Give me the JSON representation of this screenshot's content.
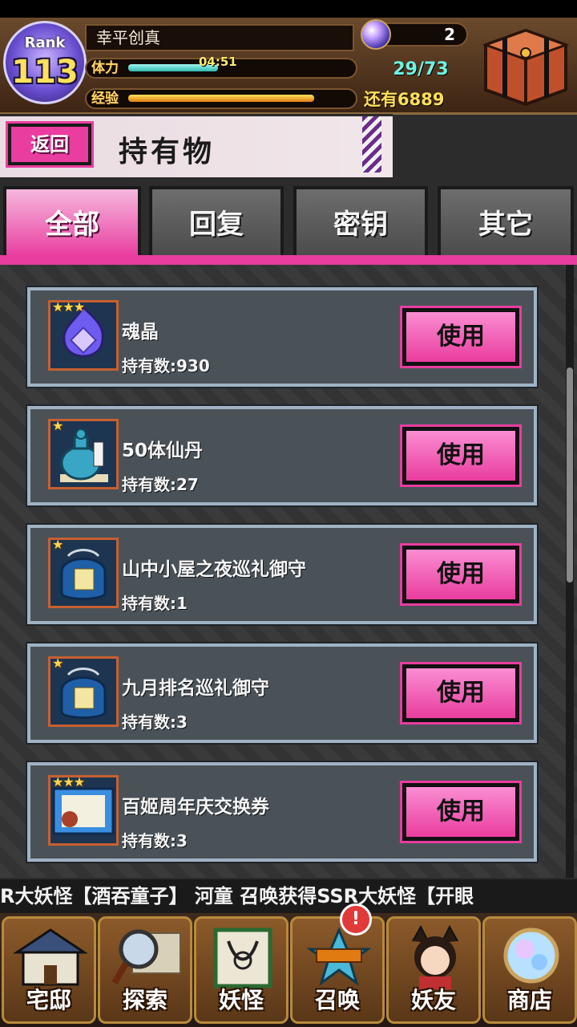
{
  "header": {
    "rank_label": "Rank",
    "rank_value": "113",
    "player_name": "幸平创真",
    "stamina_label": "体力",
    "stamina_timer": "04:51",
    "stamina_count": "29/73",
    "stamina_fraction": 0.4,
    "exp_label": "经验",
    "exp_fraction": 0.83,
    "exp_remaining": "还有6889",
    "gem_count": "2"
  },
  "title_bar": {
    "back_label": "返回",
    "title": "持有物"
  },
  "tabs": [
    {
      "label": "全部",
      "active": true
    },
    {
      "label": "回复",
      "active": false
    },
    {
      "label": "密钥",
      "active": false
    },
    {
      "label": "其它",
      "active": false
    }
  ],
  "items": [
    {
      "name": "魂晶",
      "count_text": "持有数:930",
      "stars": "★★★",
      "icon": "soul-crystal-icon",
      "use_label": "使用"
    },
    {
      "name": "50体仙丹",
      "count_text": "持有数:27",
      "stars": "★",
      "icon": "elixir-jar-icon",
      "use_label": "使用"
    },
    {
      "name": "山中小屋之夜巡礼御守",
      "count_text": "持有数:1",
      "stars": "★",
      "icon": "charm-bag-icon",
      "use_label": "使用"
    },
    {
      "name": "九月排名巡礼御守",
      "count_text": "持有数:3",
      "stars": "★",
      "icon": "charm-bag-icon",
      "use_label": "使用"
    },
    {
      "name": "百姬周年庆交换券",
      "count_text": "持有数:3",
      "stars": "★★★",
      "icon": "anniversary-ticket-icon",
      "use_label": "使用"
    }
  ],
  "ticker": {
    "text": "R大妖怪【酒吞童子】  河童 召唤获得SSR大妖怪【开眼"
  },
  "nav": [
    {
      "label": "宅邸",
      "icon": "mansion-icon"
    },
    {
      "label": "探索",
      "icon": "magnifier-map-icon"
    },
    {
      "label": "妖怪",
      "icon": "scroll-icon"
    },
    {
      "label": "召唤",
      "icon": "summon-festival-icon",
      "badge": "!"
    },
    {
      "label": "妖友",
      "icon": "friend-avatar-icon"
    },
    {
      "label": "商店",
      "icon": "crystal-orb-icon"
    }
  ],
  "colors": {
    "accent_pink": "#e93d9f",
    "stamina": "#2fb8b0",
    "exp": "#e07b12"
  }
}
